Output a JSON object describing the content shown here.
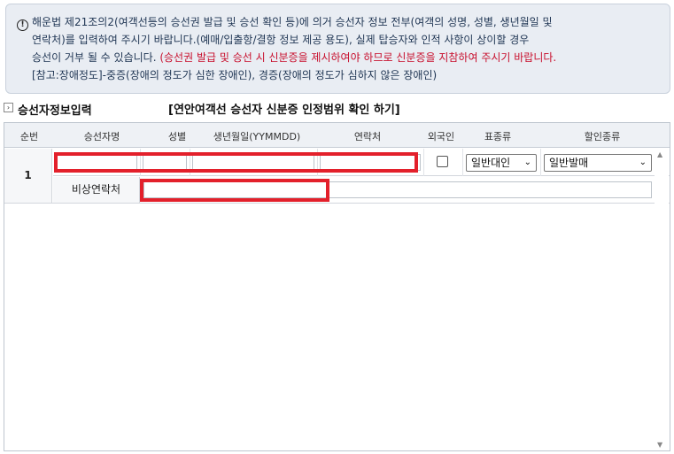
{
  "notice": {
    "line1": "해운법 제21조의2(여객선등의 승선권 발급 및 승선 확인 등)에 의거 승선자 정보 전부(여객의 성명, 성별, 생년월일 및",
    "line2": "연락처)를 입력하여 주시기 바랍니다.(예매/입출항/결항 정보 제공 용도), 실제 탑승자와 인적 사항이 상이할 경우",
    "line3_normal": "승선이 거부 될 수 있습니다. ",
    "line3_red": "(승선권 발급 및 승선 시 신분증을 제시하여야 하므로 신분증을 지참하여 주시기 바랍니다.",
    "line4": "[참고:장애정도]-중증(장애의 정도가 심한 장애인), 경증(장애의 정도가 심하지 않은 장애인)"
  },
  "section": {
    "title": "승선자정보입력",
    "link": "[연안여객선 승선자 신분증 인정범위 확인 하기]"
  },
  "grid": {
    "headers": [
      "순번",
      "승선자명",
      "성별",
      "생년월일(YYMMDD)",
      "연락처",
      "외국인",
      "표종류",
      "할인종류"
    ],
    "rows": [
      {
        "num": "1",
        "name": "",
        "gender": "",
        "birth": "",
        "phone": "",
        "foreigner": false,
        "ticket_type": "일반대인",
        "discount_type": "일반발매",
        "emergency_label": "비상연락처",
        "emergency_contact": ""
      }
    ]
  },
  "colors": {
    "highlight": "#e3202b",
    "notice_bg": "#e9edf3"
  }
}
